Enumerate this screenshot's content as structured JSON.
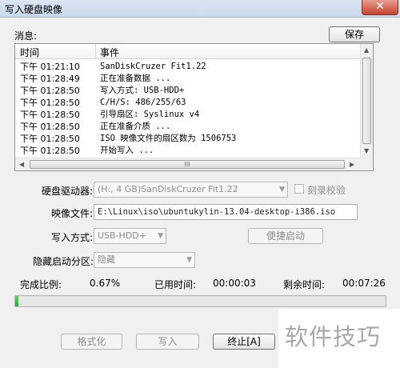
{
  "window": {
    "title": "写入硬盘映像",
    "close_label": "✕"
  },
  "messages": {
    "label": "消息:",
    "save_label": "保存",
    "columns": {
      "time": "时间",
      "event": "事件"
    },
    "rows": [
      {
        "time": "下午 01:21:10",
        "event": "SanDiskCruzer Fit1.22"
      },
      {
        "time": "下午 01:28:49",
        "event": "正在准备数据 ..."
      },
      {
        "time": "下午 01:28:50",
        "event": "写入方式: USB-HDD+"
      },
      {
        "time": "下午 01:28:50",
        "event": "C/H/S: 486/255/63"
      },
      {
        "time": "下午 01:28:50",
        "event": "引导扇区: Syslinux v4"
      },
      {
        "time": "下午 01:28:50",
        "event": "正在准备介质 ..."
      },
      {
        "time": "下午 01:28:50",
        "event": "ISO 映像文件的扇区数为 1506753"
      },
      {
        "time": "下午 01:28:50",
        "event": "开始写入 ..."
      }
    ],
    "hscroll_grip": "III"
  },
  "form": {
    "drive_label": "硬盘驱动器:",
    "drive_value": "(H:, 4 GB)SanDiskCruzer Fit1.22",
    "verify_label": "刻录校验",
    "image_label": "映像文件:",
    "image_value": "E:\\Linux\\iso\\ubuntukylin-13.04-desktop-i386.iso",
    "write_mode_label": "写入方式:",
    "write_mode_value": "USB-HDD+",
    "boot_button": "便捷启动",
    "hidden_partition_label": "隐藏启动分区:",
    "hidden_partition_value": "隐藏"
  },
  "status": {
    "percent_label": "完成比例:",
    "percent_value": "0.67%",
    "elapsed_label": "已用时间:",
    "elapsed_value": "00:00:03",
    "remaining_label": "剩余时间:",
    "remaining_value": "00:07:26",
    "progress_fraction": 0.0067
  },
  "buttons": {
    "format": "格式化",
    "write": "写入",
    "stop": "终止[A]"
  },
  "watermark": "软件技巧",
  "colors": {
    "progress": "#1fae2c",
    "close": "#c7432f"
  }
}
